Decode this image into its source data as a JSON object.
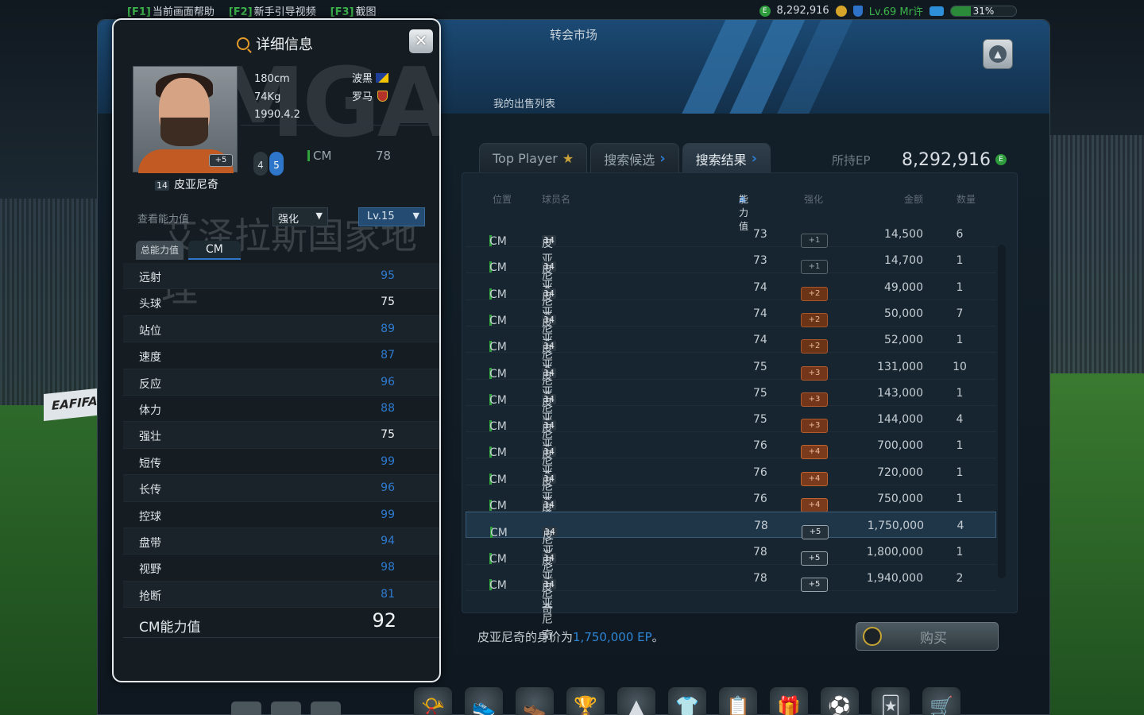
{
  "topbar": {
    "hotkeys": [
      {
        "key": "[F1]",
        "label": "当前画面帮助"
      },
      {
        "key": "[F2]",
        "label": "新手引导视频"
      },
      {
        "key": "[F3]",
        "label": "截图"
      }
    ],
    "ep": "8,292,916",
    "level": "Lv.69 Mr许",
    "progress_label": "31%",
    "progress": 0.31
  },
  "main": {
    "title": "转会市场",
    "sell_list": "我的出售列表",
    "tabs": [
      {
        "label": "Top Player",
        "icon": "star-icon"
      },
      {
        "label": "搜索候选",
        "icon": "arrow-right-icon"
      },
      {
        "label": "搜索结果",
        "icon": "arrow-right-icon"
      }
    ],
    "ep_label": "所持EP",
    "ep_value": "8,292,916"
  },
  "table": {
    "headers": [
      "位置",
      "球员名",
      "能力值",
      "强化",
      "金额",
      "数量"
    ],
    "rows": [
      {
        "pos": "CM",
        "num": "14",
        "name": "皮亚尼奇",
        "ovr": "73",
        "enh": "+1",
        "price": "14,500",
        "qty": "6"
      },
      {
        "pos": "CM",
        "num": "14",
        "name": "皮亚尼奇",
        "ovr": "73",
        "enh": "+1",
        "price": "14,700",
        "qty": "1"
      },
      {
        "pos": "CM",
        "num": "14",
        "name": "皮亚尼奇",
        "ovr": "74",
        "enh": "+2",
        "price": "49,000",
        "qty": "1"
      },
      {
        "pos": "CM",
        "num": "14",
        "name": "皮亚尼奇",
        "ovr": "74",
        "enh": "+2",
        "price": "50,000",
        "qty": "7"
      },
      {
        "pos": "CM",
        "num": "14",
        "name": "皮亚尼奇",
        "ovr": "74",
        "enh": "+2",
        "price": "52,000",
        "qty": "1"
      },
      {
        "pos": "CM",
        "num": "14",
        "name": "皮亚尼奇",
        "ovr": "75",
        "enh": "+3",
        "price": "131,000",
        "qty": "10"
      },
      {
        "pos": "CM",
        "num": "14",
        "name": "皮亚尼奇",
        "ovr": "75",
        "enh": "+3",
        "price": "143,000",
        "qty": "1"
      },
      {
        "pos": "CM",
        "num": "14",
        "name": "皮亚尼奇",
        "ovr": "75",
        "enh": "+3",
        "price": "144,000",
        "qty": "4"
      },
      {
        "pos": "CM",
        "num": "14",
        "name": "皮亚尼奇",
        "ovr": "76",
        "enh": "+4",
        "price": "700,000",
        "qty": "1"
      },
      {
        "pos": "CM",
        "num": "14",
        "name": "皮亚尼奇",
        "ovr": "76",
        "enh": "+4",
        "price": "720,000",
        "qty": "1"
      },
      {
        "pos": "CM",
        "num": "14",
        "name": "皮亚尼奇",
        "ovr": "76",
        "enh": "+4",
        "price": "750,000",
        "qty": "1"
      },
      {
        "pos": "CM",
        "num": "14",
        "name": "皮亚尼奇",
        "ovr": "78",
        "enh": "+5",
        "price": "1,750,000",
        "qty": "4",
        "selected": true
      },
      {
        "pos": "CM",
        "num": "14",
        "name": "皮亚尼奇",
        "ovr": "78",
        "enh": "+5",
        "price": "1,800,000",
        "qty": "1"
      },
      {
        "pos": "CM",
        "num": "14",
        "name": "皮亚尼奇",
        "ovr": "78",
        "enh": "+5",
        "price": "1,940,000",
        "qty": "2"
      }
    ]
  },
  "footer": {
    "price_prefix": "皮亚尼奇的身价为",
    "price_value": "1,750,000 EP",
    "price_suffix": "。",
    "buy_label": "购买"
  },
  "dock_icons": [
    "whistle-icon",
    "boot-red-icon",
    "boot-blue-icon",
    "trophy-icon",
    "formation-icon",
    "jersey-icon",
    "notepad-icon",
    "card-pack-icon",
    "club-icon",
    "card-icon",
    "cart-icon"
  ],
  "detail": {
    "title": "详细信息",
    "height": "180cm",
    "weight": "74Kg",
    "birth": "1990.4.2",
    "nation": "波黑",
    "club": "罗马",
    "plus_badge": "+5",
    "number": "14",
    "name": "皮亚尼奇",
    "skill_moves": "4",
    "weak_foot": "5",
    "position": "CM",
    "position_ovr": "78",
    "view_label": "查看能力值",
    "enh_label": "强化",
    "level_label": "Lv.15",
    "stat_tab_total": "总能力值",
    "stat_tab_pos": "CM",
    "stats": [
      {
        "name": "远射",
        "value": "95",
        "color": "blue"
      },
      {
        "name": "头球",
        "value": "75",
        "color": "white"
      },
      {
        "name": "站位",
        "value": "89",
        "color": "blue"
      },
      {
        "name": "速度",
        "value": "87",
        "color": "blue"
      },
      {
        "name": "反应",
        "value": "96",
        "color": "blue"
      },
      {
        "name": "体力",
        "value": "88",
        "color": "blue"
      },
      {
        "name": "强壮",
        "value": "75",
        "color": "white"
      },
      {
        "name": "短传",
        "value": "99",
        "color": "blue"
      },
      {
        "name": "长传",
        "value": "96",
        "color": "blue"
      },
      {
        "name": "控球",
        "value": "99",
        "color": "blue"
      },
      {
        "name": "盘带",
        "value": "94",
        "color": "blue"
      },
      {
        "name": "视野",
        "value": "98",
        "color": "blue"
      },
      {
        "name": "抢断",
        "value": "81",
        "color": "blue"
      }
    ],
    "total_label": "CM能力值",
    "total_value": "92"
  },
  "watermark": {
    "logo": "FMGA",
    "text": "艾泽拉斯国家地理"
  },
  "background_ad": "EAFIFA.Q"
}
